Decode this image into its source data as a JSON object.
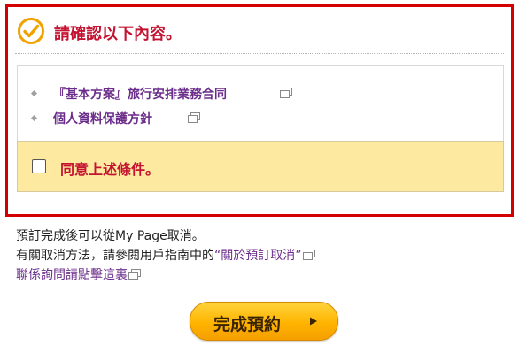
{
  "header": {
    "title": "請確認以下內容。",
    "icon": "check-circle-icon"
  },
  "documents": [
    {
      "label": "『基本方案』旅行安排業務合同",
      "icon": "new-window-icon"
    },
    {
      "label": "個人資料保護方針",
      "icon": "new-window-icon"
    }
  ],
  "agreement": {
    "label": "同意上述條件。",
    "checked": false
  },
  "info": {
    "line1": "預訂完成後可以從My Page取消。",
    "line2_text": "有關取消方法，請參閱用戶指南中的",
    "line2_link": "“關於預訂取消”",
    "line3_link": "聯係詢問請點擊這裏"
  },
  "submit": {
    "label": "完成預約",
    "icon": "play-arrow-icon"
  },
  "colors": {
    "frame": "#d40000",
    "title": "#c41230",
    "link": "#6b2d8a",
    "agree_bg": "#fdeaa0",
    "button": "#ffb400"
  }
}
